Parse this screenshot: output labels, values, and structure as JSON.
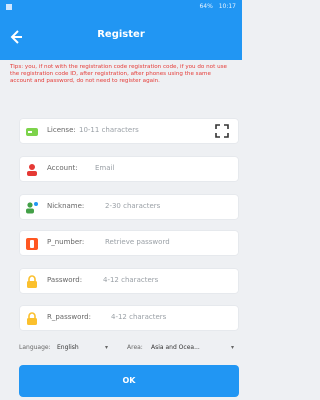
{
  "status_bar": {
    "time": "10:17",
    "battery": "64%"
  },
  "app_bar": {
    "title": "Register"
  },
  "notice": {
    "text": "Tips: you, if not with the registration code registration code, if you do not use the registration code ID, after registration, after phones using the same account and password, do not need to register again."
  },
  "fields": [
    {
      "label": "License:",
      "placeholder": "10-11 characters",
      "icon": "license-icon"
    },
    {
      "label": "Account:",
      "placeholder": "Email",
      "icon": "account-icon"
    },
    {
      "label": "Nickname:",
      "placeholder": "2-30 characters",
      "icon": "nickname-icon"
    },
    {
      "label": "P_number:",
      "placeholder": "Retrieve password",
      "icon": "phone-icon"
    },
    {
      "label": "Password:",
      "placeholder": "4-12 characters",
      "icon": "lock-icon"
    },
    {
      "label": "R_password:",
      "placeholder": "4-12 characters",
      "icon": "lock-icon"
    }
  ],
  "language": {
    "label": "Language:",
    "value": "English"
  },
  "area": {
    "label": "Area:",
    "value": "Asia and Ocea..."
  },
  "actions": {
    "ok": "OK"
  },
  "colors": {
    "primary": "#2196f3",
    "notice": "#e53935",
    "license": "#7dd34b",
    "account": "#e53935",
    "nickname": "#43a047",
    "phone": "#ff5722",
    "lock": "#fbc02d"
  }
}
